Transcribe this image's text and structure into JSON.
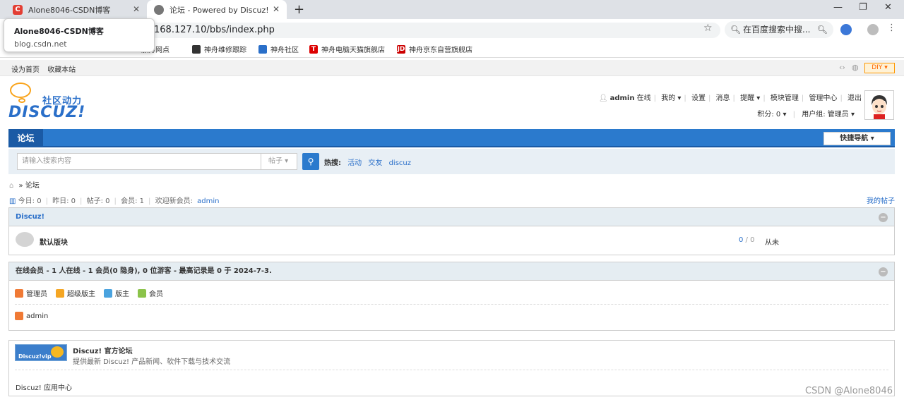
{
  "browser": {
    "tab1": {
      "title": "Alone8046-CSDN博客",
      "favicon": "C"
    },
    "tab2": {
      "title": "论坛 - Powered by Discuz!"
    },
    "url": "168.127.10/bbs/index.php",
    "search_placeholder": "在百度搜索中搜...",
    "bookmarks": [
      "服务网点",
      "神舟维修跟踪",
      "神舟社区",
      "神舟电脑天猫旗舰店",
      "神舟京东自营旗舰店"
    ],
    "tooltip": {
      "title": "Alone8046-CSDN博客",
      "url": "blog.csdn.net"
    }
  },
  "toolbar": {
    "set_home": "设为首页",
    "favorite": "收藏本站",
    "diy": "DIY"
  },
  "logo": {
    "slogan": "社区动力",
    "brand": "DISCUZ!"
  },
  "user": {
    "name": "admin",
    "status": "在线",
    "my": "我的",
    "settings": "设置",
    "messages": "消息",
    "reminder": "提醒",
    "module": "模块管理",
    "admin_center": "管理中心",
    "logout": "退出",
    "credits": "积分: 0",
    "group": "用户组: 管理员"
  },
  "nav": {
    "current": "论坛",
    "quick_nav": "快捷导航"
  },
  "search": {
    "placeholder": "请输入搜索内容",
    "type": "帖子",
    "hot_label": "热搜:",
    "hot": [
      "活动",
      "交友",
      "discuz"
    ]
  },
  "breadcrumb": {
    "current": "论坛"
  },
  "stats": {
    "today": "今日: 0",
    "yesterday": "昨日: 0",
    "posts": "帖子: 0",
    "members": "会员: 1",
    "welcome": "欢迎新会员:",
    "new_member": "admin",
    "my_posts": "我的帖子"
  },
  "forum": {
    "category": "Discuz!",
    "board": "默认版块",
    "count_a": "0",
    "count_b": "0",
    "last": "从未"
  },
  "online": {
    "title": "在线会员 - 1 人在线 - 1 会员(0 隐身), 0 位游客 - 最高记录是 0 于 2024-7-3.",
    "legend": [
      "管理员",
      "超级版主",
      "版主",
      "会员"
    ],
    "user": "admin"
  },
  "links": {
    "title": "Discuz! 官方论坛",
    "desc": "提供最新 Discuz! 产品新闻、软件下载与技术交流",
    "app_center": "Discuz! 应用中心",
    "banner_text": "Discuz!vip"
  },
  "watermark": "CSDN @Alone8046",
  "colors": {
    "accent": "#2b7acd",
    "accent_dark": "#1a5aa5",
    "link": "#2a6fc9"
  }
}
